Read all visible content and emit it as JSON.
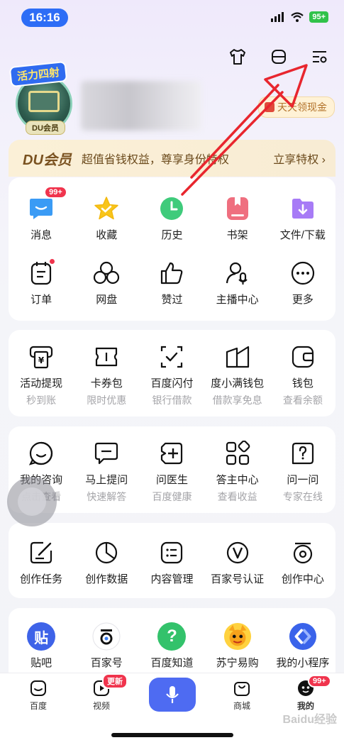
{
  "status_bar": {
    "time": "16:16",
    "battery": "95+"
  },
  "header": {
    "icons": [
      "tshirt-icon",
      "menu-lines-icon",
      "settings-list-icon"
    ],
    "avatar_badge_top": "活力四射",
    "avatar_badge_bottom": "DU会员",
    "cash_button": "天天领现金"
  },
  "vip": {
    "title": "DU会员",
    "desc": "超值省钱权益，尊享身份特权",
    "link": "立享特权 ›"
  },
  "grid1": {
    "row1": [
      {
        "label": "消息",
        "icon": "message-icon",
        "badge": "99+"
      },
      {
        "label": "收藏",
        "icon": "star-icon"
      },
      {
        "label": "历史",
        "icon": "clock-icon"
      },
      {
        "label": "书架",
        "icon": "bookshelf-icon"
      },
      {
        "label": "文件/下载",
        "icon": "folder-download-icon"
      }
    ],
    "row2": [
      {
        "label": "订单",
        "icon": "order-icon"
      },
      {
        "label": "网盘",
        "icon": "cloud-disk-icon"
      },
      {
        "label": "赞过",
        "icon": "thumbs-up-icon"
      },
      {
        "label": "主播中心",
        "icon": "anchor-icon"
      },
      {
        "label": "更多",
        "icon": "more-icon"
      }
    ]
  },
  "grid2": [
    {
      "label": "活动提现",
      "sub": "秒到账",
      "icon": "withdraw-icon"
    },
    {
      "label": "卡券包",
      "sub": "限时优惠",
      "icon": "coupon-icon"
    },
    {
      "label": "百度闪付",
      "sub": "银行借款",
      "icon": "flash-pay-icon"
    },
    {
      "label": "度小满钱包",
      "sub": "借款享免息",
      "icon": "book-wallet-icon"
    },
    {
      "label": "钱包",
      "sub": "查看余额",
      "icon": "wallet-icon"
    }
  ],
  "grid3": [
    {
      "label": "我的咨询",
      "sub": "点击查看",
      "icon": "smile-chat-icon"
    },
    {
      "label": "马上提问",
      "sub": "快速解答",
      "icon": "question-chat-icon"
    },
    {
      "label": "问医生",
      "sub": "百度健康",
      "icon": "medical-icon"
    },
    {
      "label": "答主中心",
      "sub": "查看收益",
      "icon": "grid-apps-icon"
    },
    {
      "label": "问一问",
      "sub": "专家在线",
      "icon": "question-box-icon"
    }
  ],
  "grid4": [
    {
      "label": "创作任务",
      "icon": "edit-task-icon"
    },
    {
      "label": "创作数据",
      "icon": "pie-chart-icon"
    },
    {
      "label": "内容管理",
      "icon": "list-box-icon"
    },
    {
      "label": "百家号认证",
      "icon": "verified-v-icon"
    },
    {
      "label": "创作中心",
      "icon": "create-center-icon"
    }
  ],
  "grid5": [
    {
      "label": "贴吧",
      "icon": "tieba-icon",
      "glyph": "贴"
    },
    {
      "label": "百家号",
      "icon": "baijiahao-icon"
    },
    {
      "label": "百度知道",
      "icon": "zhidao-icon",
      "glyph": "?"
    },
    {
      "label": "苏宁易购",
      "icon": "suning-icon"
    },
    {
      "label": "我的小程序",
      "icon": "mini-program-icon"
    }
  ],
  "tabbar": {
    "items": [
      {
        "label": "百度",
        "icon": "baidu-home-icon"
      },
      {
        "label": "视频",
        "icon": "video-icon",
        "badge": "更新"
      },
      {
        "label": "",
        "icon": "microphone-icon"
      },
      {
        "label": "商城",
        "icon": "shop-bag-icon"
      },
      {
        "label": "我的",
        "icon": "profile-face-icon",
        "badge": "99+"
      }
    ]
  },
  "watermark": "Baidu经验",
  "colors": {
    "accent": "#4e6bf2",
    "badge_red": "#f0344d",
    "arrow": "#e8262e"
  }
}
